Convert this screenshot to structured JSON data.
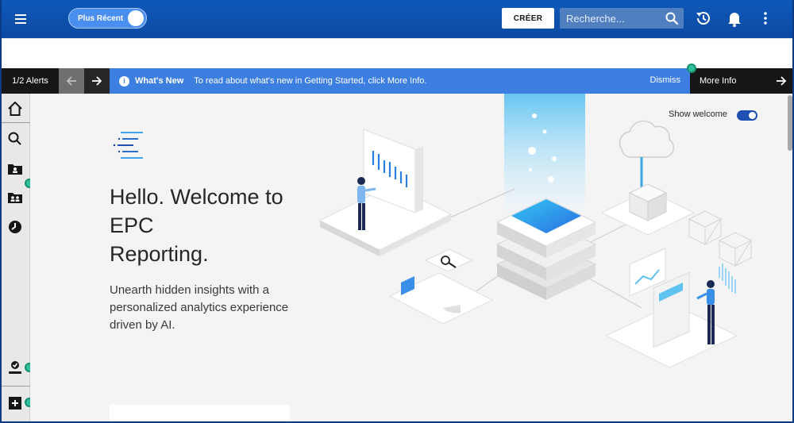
{
  "topbar": {
    "menu_icon": "hamburger-icon",
    "recent_toggle_label": "Plus Récent",
    "create_label": "CRÉER",
    "search_placeholder": "Recherche...",
    "icons": [
      "search-icon",
      "history-icon",
      "bell-icon",
      "overflow-menu-icon"
    ]
  },
  "alerts": {
    "count": "1/2 Alerts",
    "title": "What's New",
    "message": "To read about what's new in Getting Started, click More Info.",
    "dismiss_label": "Dismiss",
    "more_info_label": "More Info"
  },
  "rail": {
    "items": [
      "home-icon",
      "search-icon",
      "folder-user-icon",
      "team-folder-icon",
      "recent-clock-icon",
      "user-badge-icon",
      "add-icon"
    ]
  },
  "welcome": {
    "title_line1": "Hello. Welcome to",
    "title_line2": "EPC",
    "title_line3": "Reporting.",
    "subtitle": "Unearth hidden insights with a personalized analytics experience driven by AI.",
    "show_welcome_label": "Show welcome",
    "show_welcome_on": true
  },
  "colors": {
    "topbar": "#0b4aa3",
    "alert_blue": "#3d7fe0",
    "accent_green": "#2fbf9b",
    "toggle_blue": "#1f4fb0"
  }
}
